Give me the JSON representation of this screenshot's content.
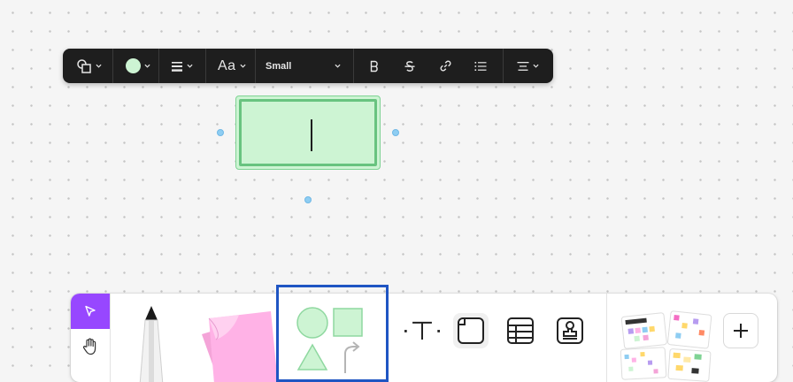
{
  "format_toolbar": {
    "shape_icon": "shapes-icon",
    "fill_color": "#cdf4d3",
    "text_style_label": "Aa",
    "font_size": "Small",
    "bold_icon": "bold-icon",
    "strike_icon": "strikethrough-icon",
    "link_icon": "link-icon",
    "list_icon": "bullet-list-icon",
    "align_icon": "align-icon"
  },
  "canvas": {
    "shape_fill": "#cdf4d3",
    "shape_border": "#68c37f",
    "handle_color": "#8ecdf2"
  },
  "toolbar": {
    "active_mode": "select",
    "accent": "#9747ff",
    "tools": [
      "select",
      "hand",
      "pen",
      "sticky-notes",
      "shapes",
      "text",
      "section",
      "table",
      "stamp",
      "templates",
      "more"
    ],
    "shapes_color": "#cdf4d3",
    "highlight_color": "#1f55c3"
  }
}
